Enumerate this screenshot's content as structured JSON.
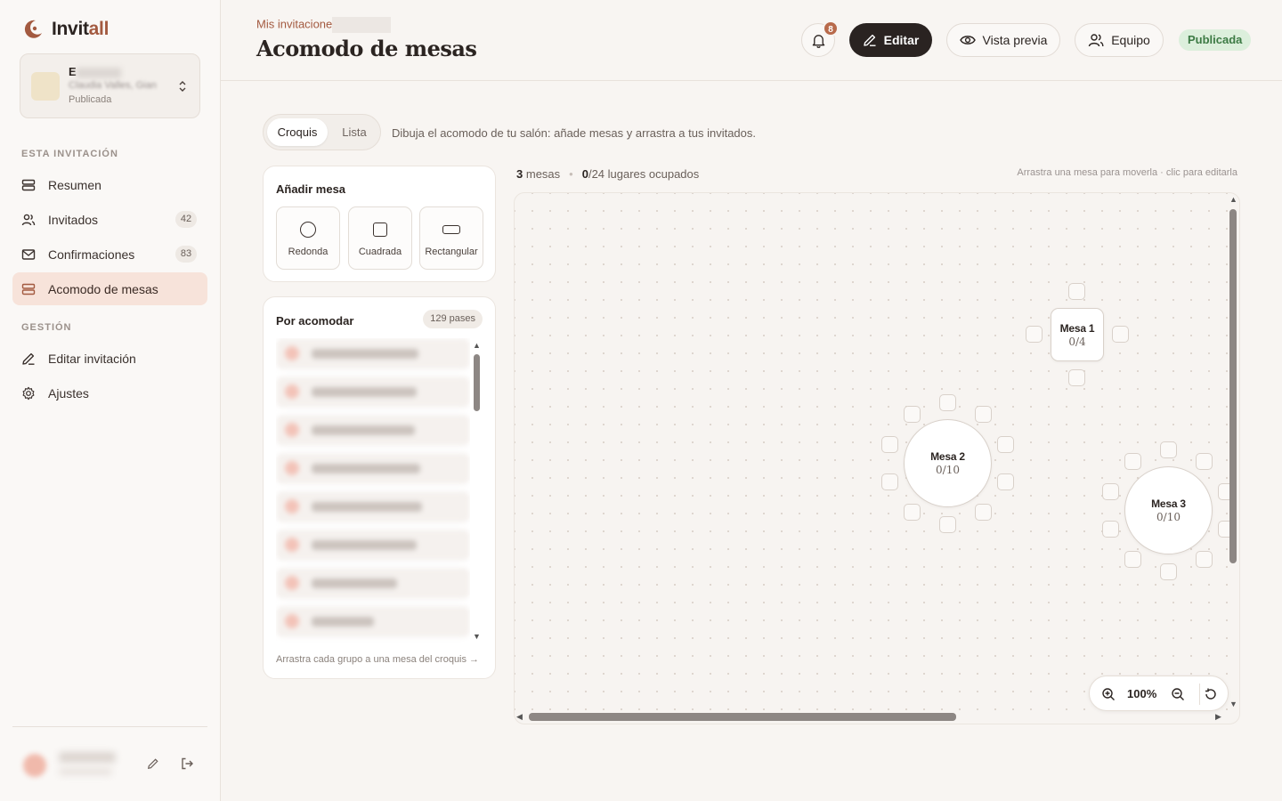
{
  "app": {
    "name_main": "Invit",
    "name_accent": "all"
  },
  "event": {
    "name_initial": "E",
    "subtitle": "Claudia Valles, Gian",
    "status": "Publicada"
  },
  "nav": {
    "section_invitation": "ESTA INVITACIÓN",
    "items": [
      {
        "label": "Resumen",
        "icon": "layers-icon"
      },
      {
        "label": "Invitados",
        "badge": "42",
        "icon": "users-icon"
      },
      {
        "label": "Confirmaciones",
        "badge": "83",
        "icon": "mail-icon"
      },
      {
        "label": "Acomodo de mesas",
        "icon": "layers-icon",
        "active": true
      }
    ],
    "section_management": "GESTIÓN",
    "management_items": [
      {
        "label": "Editar invitación",
        "icon": "pencil-icon"
      },
      {
        "label": "Ajustes",
        "icon": "gear-icon"
      }
    ]
  },
  "header": {
    "breadcrumb": "Mis invitacione",
    "title": "Acomodo de mesas",
    "notifications": "8",
    "edit_label": "Editar",
    "preview_label": "Vista previa",
    "team_label": "Equipo",
    "status": "Publicada"
  },
  "view_toggle": {
    "options": [
      "Croquis",
      "Lista"
    ],
    "selected": "Croquis"
  },
  "hint": "Dibuja el acomodo de tu salón: añade mesas y arrastra a tus invitados.",
  "add_table": {
    "title": "Añadir mesa",
    "types": [
      {
        "label": "Redonda",
        "icon": "circle-icon"
      },
      {
        "label": "Cuadrada",
        "icon": "square-icon"
      },
      {
        "label": "Rectangular",
        "icon": "rectangle-icon"
      }
    ]
  },
  "pending": {
    "title": "Por acomodar",
    "count": "129 pases",
    "footer": "Arrastra cada grupo a una mesa del croquis →"
  },
  "canvas_stats": {
    "tables_count": "3",
    "tables_label": "mesas",
    "occupied": "0",
    "occupied_suffix": "/24 lugares ocupados",
    "hint": "Arrastra una mesa para moverla · clic para editarla"
  },
  "tables": [
    {
      "name": "Mesa 1",
      "occupancy": "0/4",
      "shape": "square"
    },
    {
      "name": "Mesa 2",
      "occupancy": "0/10",
      "shape": "round"
    },
    {
      "name": "Mesa 3",
      "occupancy": "0/10",
      "shape": "round"
    }
  ],
  "zoom": {
    "level": "100%"
  },
  "colors": {
    "accent": "#a35a40",
    "dark": "#2a2321",
    "active_bg": "#f7e3da",
    "success_bg": "#dcefdc",
    "success_text": "#3c7a44"
  }
}
